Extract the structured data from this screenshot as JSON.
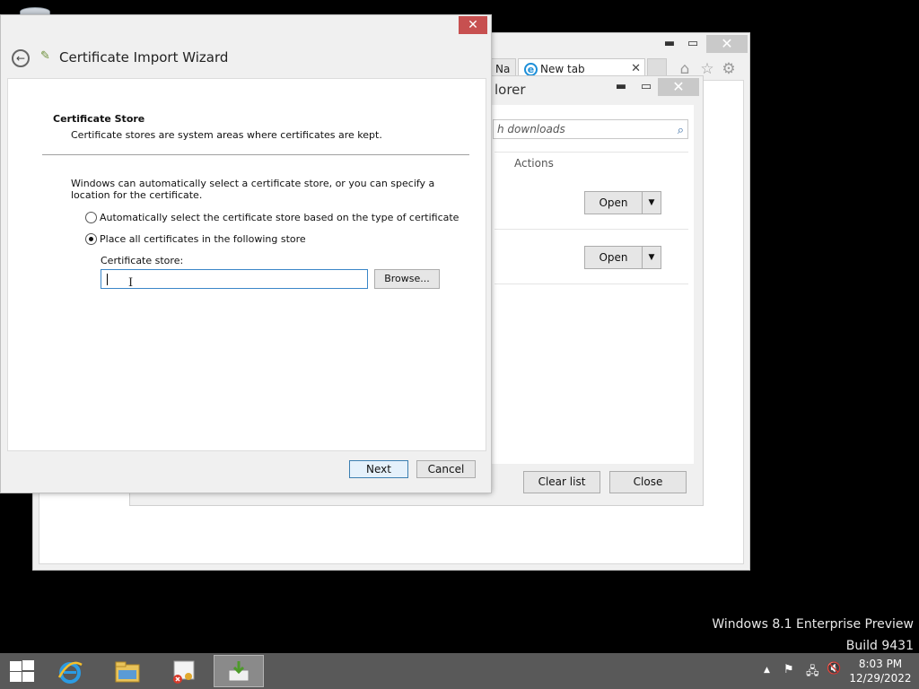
{
  "ie": {
    "tab_partial": "Na",
    "tab_new": "New tab",
    "tab_close": "✕",
    "min": "▬",
    "max": "▭",
    "close": "✕"
  },
  "downloads": {
    "title_partial": "lorer",
    "search_placeholder": "h downloads",
    "actions_header": "Actions",
    "items": [
      {
        "open_label": "Open",
        "arrow": "▼"
      },
      {
        "open_label": "Open",
        "arrow": "▼"
      }
    ],
    "clear_list": "Clear list",
    "close": "Close",
    "min": "▬",
    "max": "▭",
    "x": "✕"
  },
  "wizard": {
    "title": "Certificate Import Wizard",
    "close": "✕",
    "section_heading": "Certificate Store",
    "section_desc": "Certificate stores are system areas where certificates are kept.",
    "body": "Windows can automatically select a certificate store, or you can specify a location for the certificate.",
    "radio_auto": "Automatically select the certificate store based on the type of certificate",
    "radio_place": "Place all certificates in the following store",
    "radio_selected": "place",
    "store_label": "Certificate store:",
    "store_value": "",
    "browse": "Browse...",
    "next": "Next",
    "cancel": "Cancel"
  },
  "watermark": {
    "line1": "Windows 8.1 Enterprise Preview",
    "line2": "Build 9431"
  },
  "taskbar": {
    "time": "8:03 PM",
    "date": "12/29/2022",
    "tray_arrow": "▲"
  },
  "colors": {
    "taskbar": "#595959",
    "wizard_close": "#c75050",
    "ie_blue": "#1d8fd8",
    "focus_border": "#3a86c8"
  }
}
